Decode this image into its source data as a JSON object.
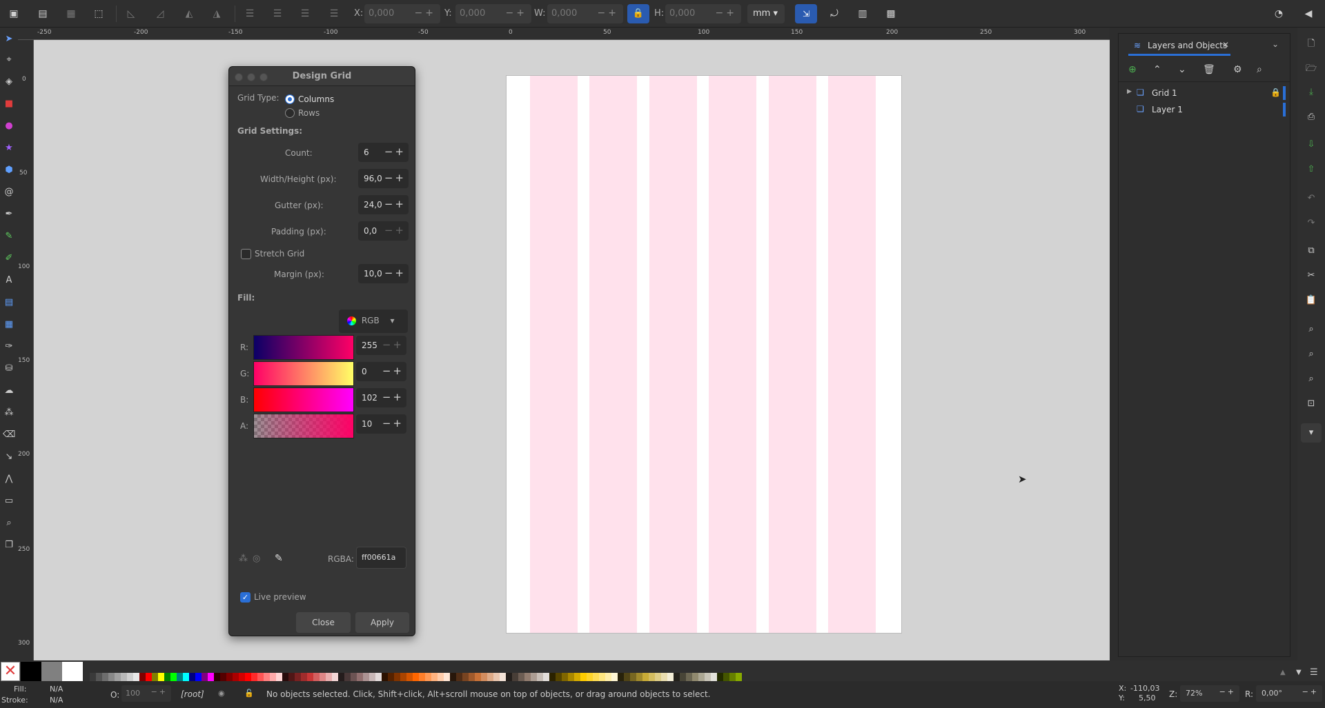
{
  "toolbar": {
    "x_label": "X:",
    "x_value": "0,000",
    "y_label": "Y:",
    "y_value": "0,000",
    "w_label": "W:",
    "w_value": "0,000",
    "h_label": "H:",
    "h_value": "0,000",
    "unit": "mm"
  },
  "ruler": {
    "h_ticks": [
      "-250",
      "-200",
      "-150",
      "-100",
      "-50",
      "0",
      "50",
      "100",
      "150",
      "200",
      "250",
      "300"
    ],
    "v_ticks": [
      "0",
      "50",
      "100",
      "150",
      "200",
      "250",
      "300"
    ]
  },
  "dialog": {
    "title": "Design Grid",
    "grid_type_label": "Grid Type:",
    "option_columns": "Columns",
    "option_rows": "Rows",
    "grid_settings_label": "Grid Settings:",
    "count_label": "Count:",
    "count_value": "6",
    "width_label": "Width/Height (px):",
    "width_value": "96,0",
    "gutter_label": "Gutter (px):",
    "gutter_value": "24,0",
    "padding_label": "Padding (px):",
    "padding_value": "0,0",
    "stretch_label": "Stretch Grid",
    "margin_label": "Margin (px):",
    "margin_value": "10,0",
    "fill_label": "Fill:",
    "color_mode": "RGB",
    "r_label": "R:",
    "r_value": "255",
    "g_label": "G:",
    "g_value": "0",
    "b_label": "B:",
    "b_value": "102",
    "a_label": "A:",
    "a_value": "10",
    "rgba_label": "RGBA:",
    "rgba_value": "ff00661a",
    "live_preview_label": "Live preview",
    "close_label": "Close",
    "apply_label": "Apply"
  },
  "panel": {
    "tab_title": "Layers and Objects",
    "layers": [
      {
        "name": "Grid 1",
        "locked": true
      },
      {
        "name": "Layer 1",
        "locked": false
      }
    ]
  },
  "status": {
    "fill_label": "Fill:",
    "fill_value": "N/A",
    "stroke_label": "Stroke:",
    "stroke_value": "N/A",
    "opacity_label": "O:",
    "opacity_value": "100",
    "layer": "[root]",
    "message": "No objects selected. Click, Shift+click, Alt+scroll mouse on top of objects, or drag around objects to select.",
    "x_label": "X:",
    "x_value": "-110,03",
    "y_label": "Y:",
    "y_value": "5,50",
    "zoom_label": "Z:",
    "zoom_value": "72%",
    "rotate_label": "R:",
    "rotate_value": "0,00°"
  },
  "colors": {
    "accent": "#2a6fd6",
    "grid_fill": "#ffe1ec",
    "canvas_bg": "#d3d3d3"
  }
}
